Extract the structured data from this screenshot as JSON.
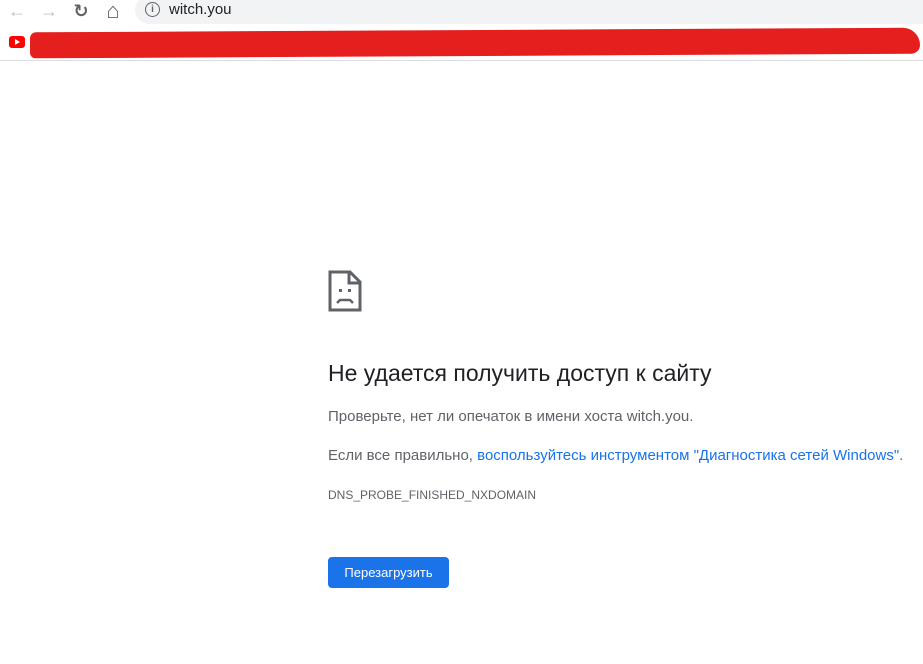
{
  "browser": {
    "url": "witch.you",
    "back_icon": "←",
    "forward_icon": "→",
    "reload_icon": "↻",
    "home_icon": "⌂",
    "info_icon": "i"
  },
  "error": {
    "title": "Не удается получить доступ к сайту",
    "check_text": "Проверьте, нет ли опечаток в имени хоста witch.you.",
    "if_correct_prefix": "Если все правильно, ",
    "diagnostics_link": "воспользуйтесь инструментом \"Диагностика сетей Windows\"",
    "if_correct_suffix": ".",
    "error_code": "DNS_PROBE_FINISHED_NXDOMAIN",
    "reload_button": "Перезагрузить"
  }
}
